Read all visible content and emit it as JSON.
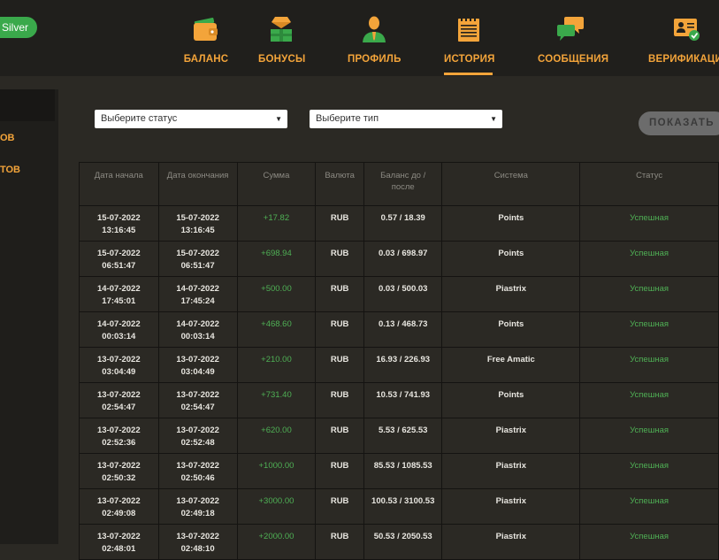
{
  "badge": "Silver",
  "nav": [
    {
      "label": "БАЛАНС",
      "icon": "wallet-icon"
    },
    {
      "label": "БОНУСЫ",
      "icon": "gift-icon"
    },
    {
      "label": "ПРОФИЛЬ",
      "icon": "user-icon"
    },
    {
      "label": "ИСТОРИЯ",
      "icon": "notepad-icon",
      "active": true
    },
    {
      "label": "СООБЩЕНИЯ",
      "icon": "chat-icon"
    },
    {
      "label": "ВЕРИФИКАЦИЯ",
      "icon": "id-card-icon"
    }
  ],
  "sidebar": {
    "items": [
      "ОВ",
      "ТОВ"
    ]
  },
  "filters": {
    "status_placeholder": "Выберите статус",
    "type_placeholder": "Выберите тип",
    "show_button": "ПОКАЗАТЬ"
  },
  "table": {
    "headers": [
      "Дата начала",
      "Дата окончания",
      "Сумма",
      "Валюта",
      "Баланс до / после",
      "Система",
      "Статус"
    ],
    "rows": [
      {
        "start_date": "15-07-2022",
        "start_time": "13:16:45",
        "end_date": "15-07-2022",
        "end_time": "13:16:45",
        "amount": "+17.82",
        "currency": "RUB",
        "balance": "0.57 / 18.39",
        "system": "Points",
        "status": "Успешная"
      },
      {
        "start_date": "15-07-2022",
        "start_time": "06:51:47",
        "end_date": "15-07-2022",
        "end_time": "06:51:47",
        "amount": "+698.94",
        "currency": "RUB",
        "balance": "0.03 / 698.97",
        "system": "Points",
        "status": "Успешная"
      },
      {
        "start_date": "14-07-2022",
        "start_time": "17:45:01",
        "end_date": "14-07-2022",
        "end_time": "17:45:24",
        "amount": "+500.00",
        "currency": "RUB",
        "balance": "0.03 / 500.03",
        "system": "Piastrix",
        "status": "Успешная"
      },
      {
        "start_date": "14-07-2022",
        "start_time": "00:03:14",
        "end_date": "14-07-2022",
        "end_time": "00:03:14",
        "amount": "+468.60",
        "currency": "RUB",
        "balance": "0.13 / 468.73",
        "system": "Points",
        "status": "Успешная"
      },
      {
        "start_date": "13-07-2022",
        "start_time": "03:04:49",
        "end_date": "13-07-2022",
        "end_time": "03:04:49",
        "amount": "+210.00",
        "currency": "RUB",
        "balance": "16.93 / 226.93",
        "system": "Free Amatic",
        "status": "Успешная"
      },
      {
        "start_date": "13-07-2022",
        "start_time": "02:54:47",
        "end_date": "13-07-2022",
        "end_time": "02:54:47",
        "amount": "+731.40",
        "currency": "RUB",
        "balance": "10.53 / 741.93",
        "system": "Points",
        "status": "Успешная"
      },
      {
        "start_date": "13-07-2022",
        "start_time": "02:52:36",
        "end_date": "13-07-2022",
        "end_time": "02:52:48",
        "amount": "+620.00",
        "currency": "RUB",
        "balance": "5.53 / 625.53",
        "system": "Piastrix",
        "status": "Успешная"
      },
      {
        "start_date": "13-07-2022",
        "start_time": "02:50:32",
        "end_date": "13-07-2022",
        "end_time": "02:50:46",
        "amount": "+1000.00",
        "currency": "RUB",
        "balance": "85.53 / 1085.53",
        "system": "Piastrix",
        "status": "Успешная"
      },
      {
        "start_date": "13-07-2022",
        "start_time": "02:49:08",
        "end_date": "13-07-2022",
        "end_time": "02:49:18",
        "amount": "+3000.00",
        "currency": "RUB",
        "balance": "100.53 / 3100.53",
        "system": "Piastrix",
        "status": "Успешная"
      },
      {
        "start_date": "13-07-2022",
        "start_time": "02:48:01",
        "end_date": "13-07-2022",
        "end_time": "02:48:10",
        "amount": "+2000.00",
        "currency": "RUB",
        "balance": "50.53 / 2050.53",
        "system": "Piastrix",
        "status": "Успешная"
      }
    ]
  },
  "colors": {
    "accent": "#f3a43a",
    "success": "#4fb055",
    "badge": "#3aa94b"
  }
}
